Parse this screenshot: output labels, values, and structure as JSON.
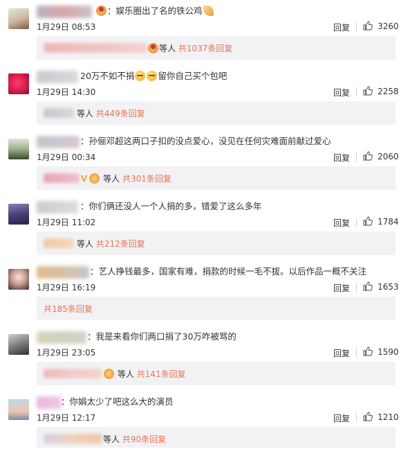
{
  "colors": {
    "background": "#ffffff",
    "reply_box": "#f2f2f5",
    "reply_count": "#eb7350",
    "text": "#333333"
  },
  "ui": {
    "reply_label": "回复",
    "like_icon": "thumbs-up-icon",
    "etc_label": "等人"
  },
  "comments": [
    {
      "text": "：娱乐圈出了名的铁公鸡",
      "time": "1月29日 08:53",
      "likes": "3260",
      "reply_count": "共1037条回复"
    },
    {
      "text_a": "20万不如不捐",
      "text_b": "留你自己买个包吧",
      "time": "1月29日 14:30",
      "likes": "2258",
      "reply_count": "共449条回复"
    },
    {
      "text": "：孙俪邓超这两口子扣的没点爱心，没见在任何灾难面前献过爱心",
      "time": "1月29日 00:34",
      "likes": "2060",
      "reply_count": "共301条回复"
    },
    {
      "text": "：你们俩还没人一个人捐的多，错爱了这么多年",
      "time": "1月29日 11:02",
      "likes": "1784",
      "reply_count": "共212条回复"
    },
    {
      "text": "：艺人挣钱最多，国家有难，捐款的时候一毛不拔。以后作品一概不关注",
      "time": "1月29日 16:19",
      "likes": "1653",
      "reply_count": "共185条回复"
    },
    {
      "text": "：我是来看你们两口捐了30万咋被骂的",
      "time": "1月29日 23:05",
      "likes": "1590",
      "reply_count": "共141条回复"
    },
    {
      "text": "：你娟太少了吧这么大的演员",
      "time": "1月29日 12:17",
      "likes": "1210",
      "reply_count": "共90条回复"
    }
  ]
}
